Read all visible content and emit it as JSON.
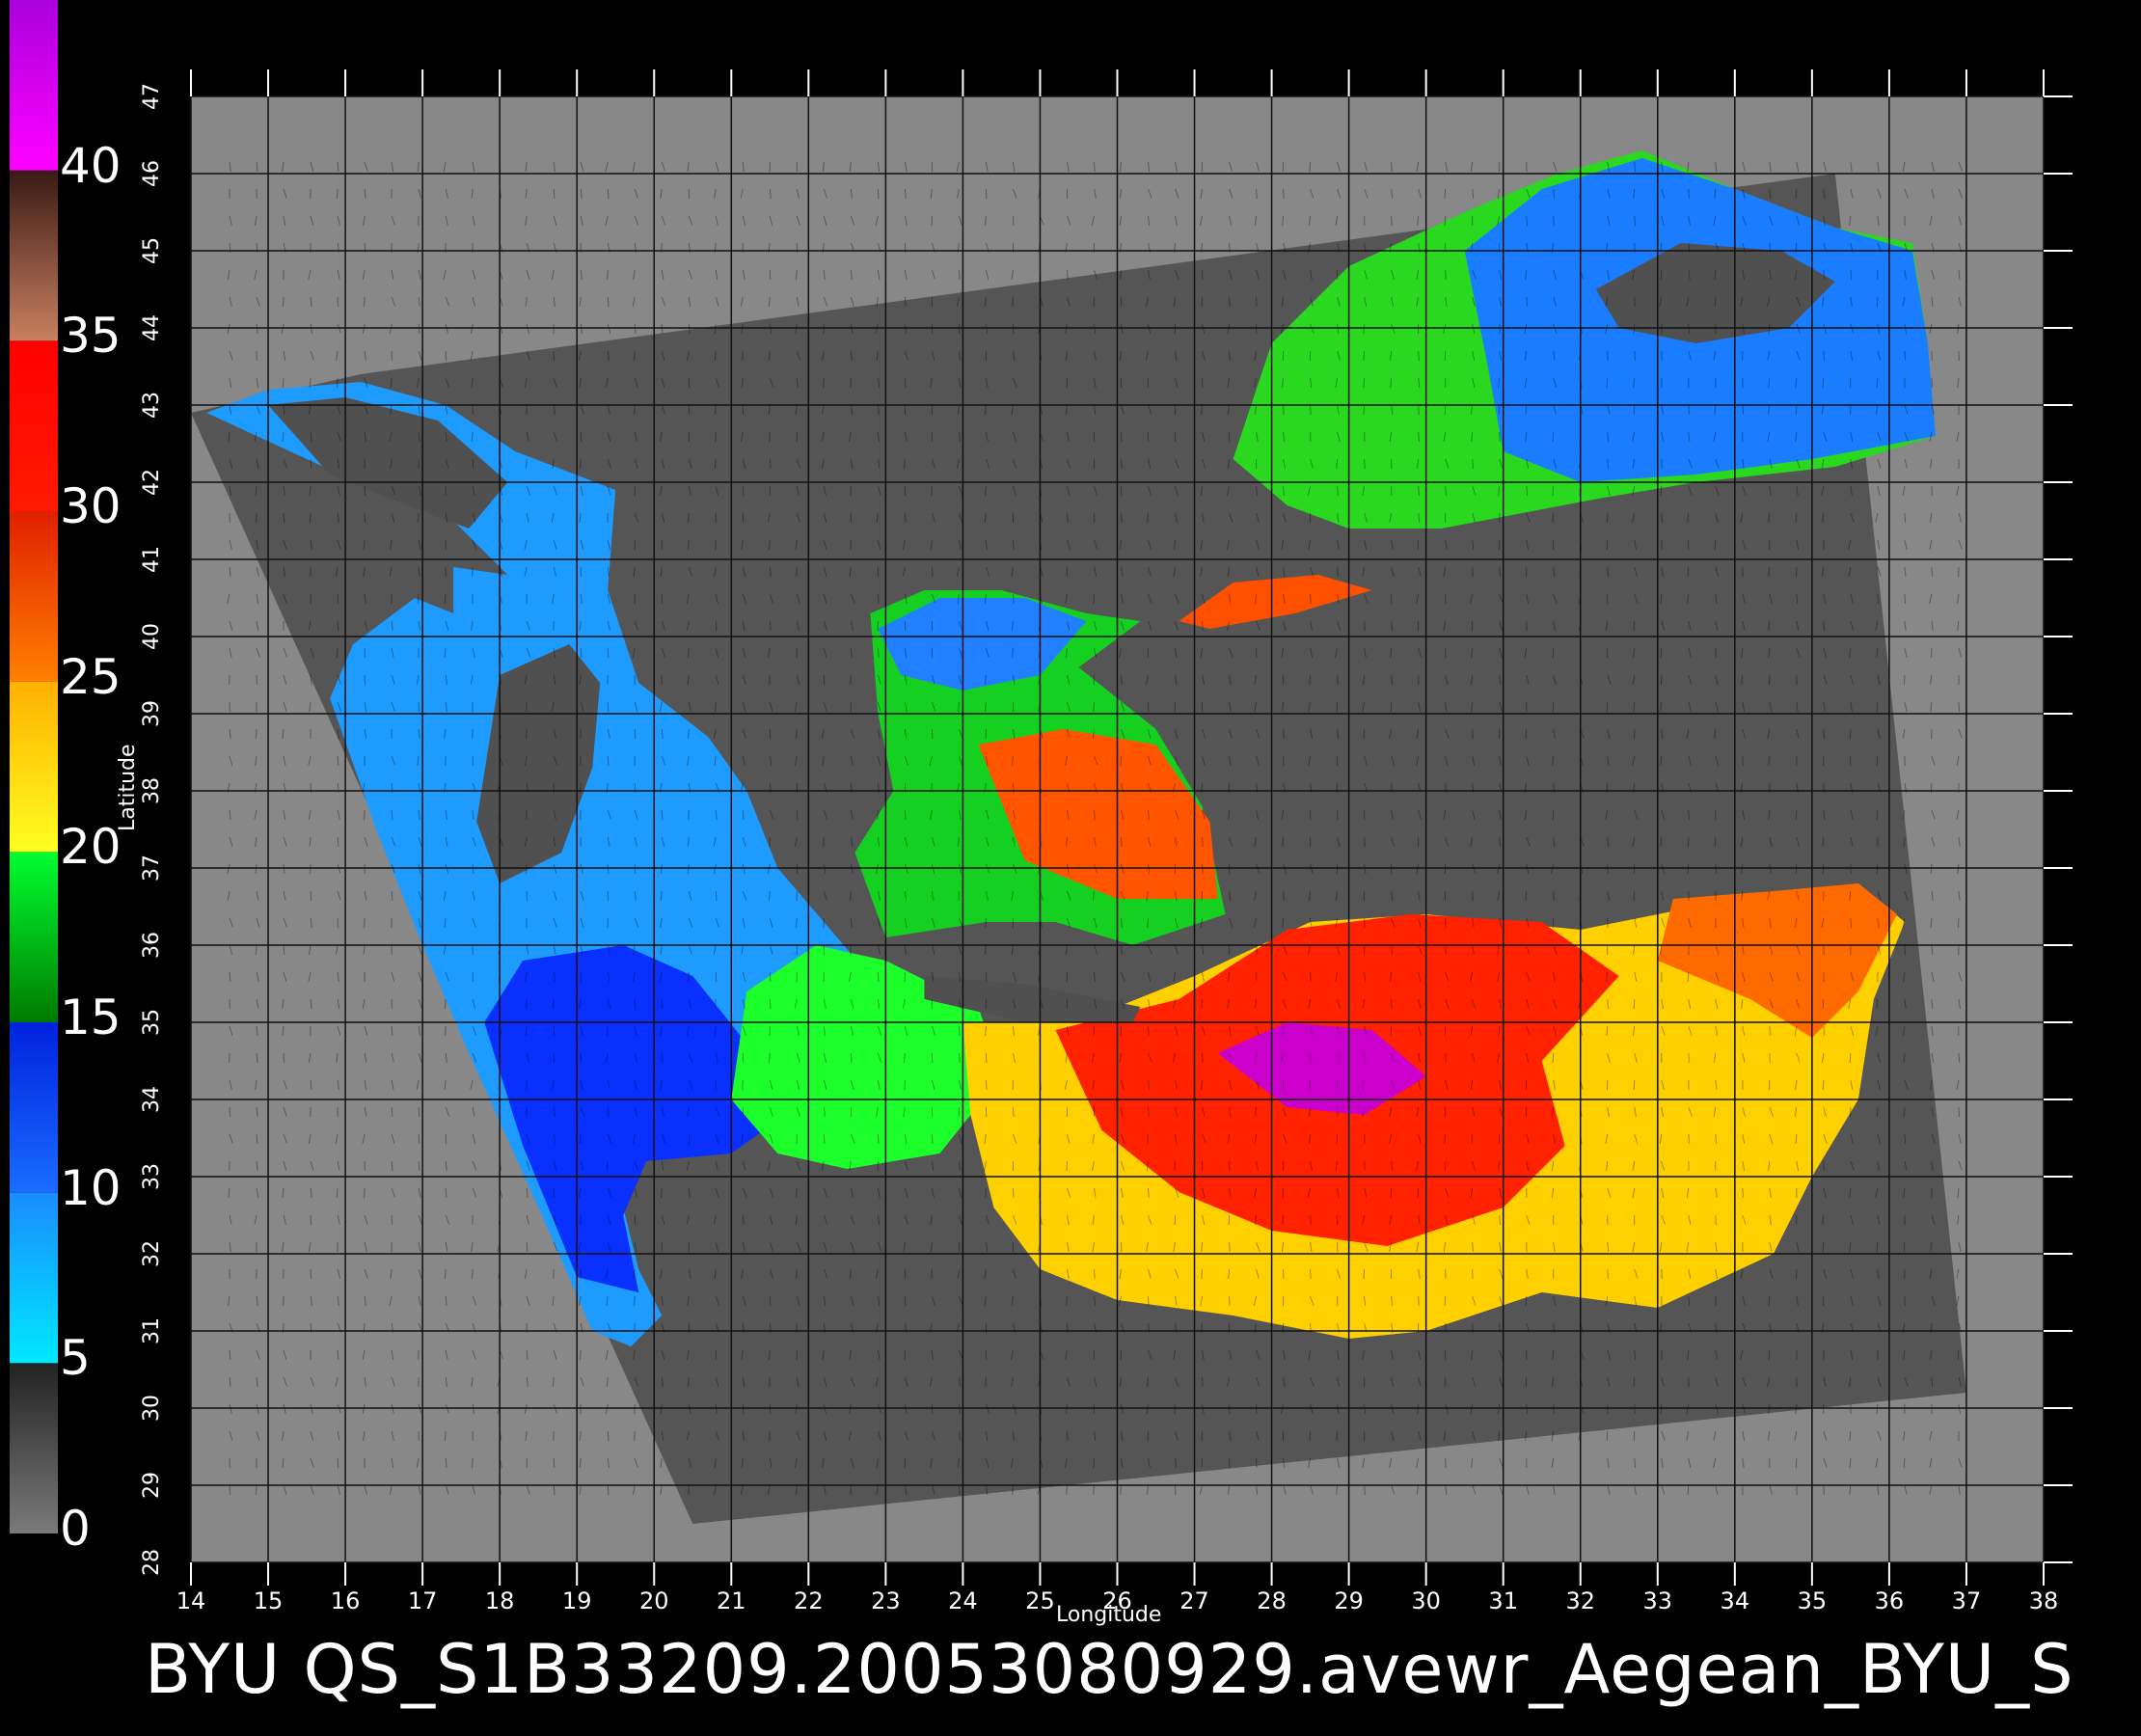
{
  "title": "BYU  QS_S1B33209.20053080929.avewr_Aegean_BYU_S",
  "colorbar": {
    "labels": [
      "40",
      "35",
      "30",
      "25",
      "20",
      "15",
      "10",
      "5",
      "0"
    ],
    "segments": [
      {
        "from": 0,
        "to": 5,
        "colors": [
          "#7a7a7a",
          "#222222"
        ]
      },
      {
        "from": 5,
        "to": 10,
        "colors": [
          "#00e8ff",
          "#1a8cff"
        ]
      },
      {
        "from": 10,
        "to": 15,
        "colors": [
          "#1a6cff",
          "#0022dd"
        ]
      },
      {
        "from": 15,
        "to": 20,
        "colors": [
          "#007a00",
          "#00ff30"
        ]
      },
      {
        "from": 20,
        "to": 25,
        "colors": [
          "#ffff20",
          "#ffb000"
        ]
      },
      {
        "from": 25,
        "to": 30,
        "colors": [
          "#ff8000",
          "#e02000"
        ]
      },
      {
        "from": 30,
        "to": 35,
        "colors": [
          "#ff1a00",
          "#ff0000"
        ]
      },
      {
        "from": 35,
        "to": 40,
        "colors": [
          "#c88060",
          "#3a1a14"
        ]
      },
      {
        "from": 40,
        "to": 45,
        "colors": [
          "#ff00ff",
          "#aa00dd"
        ]
      }
    ]
  },
  "axes": {
    "xlabel": "Longitude",
    "ylabel": "Latitude",
    "xlim": [
      14,
      38
    ],
    "ylim": [
      28,
      47
    ],
    "xticks": [
      14,
      15,
      16,
      17,
      18,
      19,
      20,
      21,
      22,
      23,
      24,
      25,
      26,
      27,
      28,
      29,
      30,
      31,
      32,
      33,
      34,
      35,
      36,
      37,
      38
    ],
    "yticks": [
      28,
      29,
      30,
      31,
      32,
      33,
      34,
      35,
      36,
      37,
      38,
      39,
      40,
      41,
      42,
      43,
      44,
      45,
      46,
      47
    ],
    "grid": true
  },
  "colors": {
    "background": "#000000",
    "land": "#888888",
    "swath": "#555555",
    "grid": "#111111"
  },
  "wind_regions": [
    {
      "name": "adriatic-ionian",
      "color": "#1e9bff",
      "outline": [
        [
          14.2,
          42.9
        ],
        [
          15.0,
          43.2
        ],
        [
          16.2,
          43.3
        ],
        [
          17.3,
          43.0
        ],
        [
          18.2,
          42.4
        ],
        [
          19.5,
          41.9
        ],
        [
          19.4,
          40.6
        ],
        [
          19.8,
          39.4
        ],
        [
          20.7,
          38.7
        ],
        [
          21.2,
          38.0
        ],
        [
          21.6,
          37.0
        ],
        [
          22.2,
          36.3
        ],
        [
          22.8,
          35.6
        ],
        [
          22.0,
          35.0
        ],
        [
          21.3,
          34.4
        ],
        [
          20.6,
          33.8
        ],
        [
          19.9,
          33.4
        ],
        [
          19.6,
          32.6
        ],
        [
          19.8,
          31.8
        ],
        [
          20.1,
          31.2
        ],
        [
          19.7,
          30.8
        ],
        [
          19.2,
          31.0
        ],
        [
          18.5,
          32.6
        ],
        [
          17.6,
          34.6
        ],
        [
          17.0,
          36.0
        ],
        [
          16.4,
          37.5
        ],
        [
          15.8,
          39.2
        ],
        [
          16.1,
          39.9
        ],
        [
          16.9,
          40.5
        ],
        [
          17.4,
          40.3
        ],
        [
          17.4,
          40.9
        ],
        [
          18.1,
          40.8
        ],
        [
          17.4,
          41.5
        ],
        [
          16.4,
          41.9
        ],
        [
          15.5,
          42.3
        ]
      ]
    },
    {
      "name": "adriatic-calm-1",
      "color": "#505050",
      "outline": [
        [
          15.0,
          43.0
        ],
        [
          16.0,
          43.1
        ],
        [
          17.2,
          42.8
        ],
        [
          18.1,
          42.0
        ],
        [
          17.6,
          41.4
        ],
        [
          16.8,
          41.7
        ],
        [
          15.8,
          42.1
        ]
      ]
    },
    {
      "name": "ionian-calm-2",
      "color": "#505050",
      "outline": [
        [
          18.0,
          39.5
        ],
        [
          18.9,
          39.9
        ],
        [
          19.3,
          39.4
        ],
        [
          19.2,
          38.3
        ],
        [
          18.8,
          37.2
        ],
        [
          18.0,
          36.8
        ],
        [
          17.7,
          37.6
        ]
      ]
    },
    {
      "name": "ionian-blue",
      "color": "#0a30ff",
      "outline": [
        [
          18.3,
          35.8
        ],
        [
          19.6,
          36.0
        ],
        [
          20.5,
          35.6
        ],
        [
          21.3,
          34.6
        ],
        [
          21.7,
          33.8
        ],
        [
          21.0,
          33.3
        ],
        [
          19.9,
          33.2
        ],
        [
          19.6,
          32.5
        ],
        [
          19.8,
          31.5
        ],
        [
          19.0,
          31.7
        ],
        [
          18.3,
          33.4
        ],
        [
          17.8,
          35.0
        ]
      ]
    },
    {
      "name": "libyan-green",
      "color": "#1cff2a",
      "outline": [
        [
          21.2,
          35.4
        ],
        [
          22.1,
          36.0
        ],
        [
          23.0,
          35.8
        ],
        [
          24.2,
          35.2
        ],
        [
          24.5,
          34.3
        ],
        [
          23.7,
          33.3
        ],
        [
          22.5,
          33.1
        ],
        [
          21.6,
          33.3
        ],
        [
          21.0,
          34.0
        ]
      ]
    },
    {
      "name": "aegean-mix",
      "color": "#15d020",
      "outline": [
        [
          22.8,
          40.3
        ],
        [
          23.5,
          40.6
        ],
        [
          24.5,
          40.6
        ],
        [
          25.6,
          40.3
        ],
        [
          26.3,
          40.2
        ],
        [
          25.5,
          39.6
        ],
        [
          26.5,
          38.8
        ],
        [
          27.1,
          37.8
        ],
        [
          27.4,
          36.4
        ],
        [
          26.2,
          36.0
        ],
        [
          25.2,
          36.3
        ],
        [
          24.3,
          36.3
        ],
        [
          23.0,
          36.1
        ],
        [
          22.6,
          37.2
        ],
        [
          23.1,
          38.0
        ],
        [
          22.9,
          39.0
        ]
      ]
    },
    {
      "name": "aegean-blue",
      "color": "#2080ff",
      "outline": [
        [
          22.9,
          40.1
        ],
        [
          23.7,
          40.5
        ],
        [
          24.8,
          40.5
        ],
        [
          25.6,
          40.2
        ],
        [
          25.0,
          39.5
        ],
        [
          24.0,
          39.3
        ],
        [
          23.2,
          39.5
        ]
      ]
    },
    {
      "name": "aegean-orange",
      "color": "#ff5500",
      "outline": [
        [
          24.2,
          38.6
        ],
        [
          25.3,
          38.8
        ],
        [
          26.5,
          38.6
        ],
        [
          27.2,
          37.6
        ],
        [
          27.3,
          36.6
        ],
        [
          26.0,
          36.6
        ],
        [
          24.8,
          37.1
        ]
      ]
    },
    {
      "name": "levantine-yellow",
      "color": "#ffd000",
      "outline": [
        [
          24.0,
          35.0
        ],
        [
          25.5,
          35.0
        ],
        [
          27.0,
          35.6
        ],
        [
          28.5,
          36.3
        ],
        [
          30.0,
          36.4
        ],
        [
          32.0,
          36.2
        ],
        [
          34.0,
          36.6
        ],
        [
          35.6,
          36.8
        ],
        [
          36.2,
          36.3
        ],
        [
          35.8,
          35.3
        ],
        [
          35.6,
          34.0
        ],
        [
          35.0,
          33.0
        ],
        [
          34.5,
          32.0
        ],
        [
          33.0,
          31.3
        ],
        [
          31.5,
          31.5
        ],
        [
          30.0,
          31.0
        ],
        [
          29.0,
          30.9
        ],
        [
          27.5,
          31.2
        ],
        [
          26.0,
          31.4
        ],
        [
          25.0,
          31.8
        ],
        [
          24.4,
          32.6
        ],
        [
          24.1,
          33.8
        ]
      ]
    },
    {
      "name": "levantine-red",
      "color": "#ff2200",
      "outline": [
        [
          25.2,
          34.9
        ],
        [
          26.8,
          35.3
        ],
        [
          28.2,
          36.2
        ],
        [
          29.8,
          36.4
        ],
        [
          31.5,
          36.3
        ],
        [
          32.5,
          35.6
        ],
        [
          31.5,
          34.5
        ],
        [
          31.8,
          33.4
        ],
        [
          31.0,
          32.6
        ],
        [
          29.5,
          32.1
        ],
        [
          28.0,
          32.3
        ],
        [
          26.8,
          32.8
        ],
        [
          25.8,
          33.6
        ]
      ]
    },
    {
      "name": "levantine-magenta",
      "color": "#cc00cc",
      "outline": [
        [
          27.3,
          34.6
        ],
        [
          28.2,
          35.0
        ],
        [
          29.3,
          34.9
        ],
        [
          30.0,
          34.3
        ],
        [
          29.2,
          33.8
        ],
        [
          28.2,
          33.9
        ]
      ]
    },
    {
      "name": "levantine-orange-east",
      "color": "#ff6a00",
      "outline": [
        [
          33.2,
          36.6
        ],
        [
          34.5,
          36.7
        ],
        [
          35.6,
          36.8
        ],
        [
          36.1,
          36.4
        ],
        [
          35.6,
          35.4
        ],
        [
          35.0,
          34.8
        ],
        [
          34.2,
          35.3
        ],
        [
          33.0,
          35.8
        ]
      ]
    },
    {
      "name": "crete-calm",
      "color": "#505050",
      "outline": [
        [
          23.5,
          35.6
        ],
        [
          24.8,
          35.5
        ],
        [
          26.3,
          35.2
        ],
        [
          26.2,
          35.0
        ],
        [
          24.8,
          35.0
        ],
        [
          23.5,
          35.3
        ]
      ]
    },
    {
      "name": "black-sea-green",
      "color": "#2ad820",
      "outline": [
        [
          27.6,
          42.6
        ],
        [
          28.0,
          43.8
        ],
        [
          29.0,
          44.8
        ],
        [
          30.5,
          45.5
        ],
        [
          31.7,
          46.0
        ],
        [
          32.8,
          46.3
        ],
        [
          34.0,
          45.8
        ],
        [
          35.3,
          45.3
        ],
        [
          36.3,
          45.1
        ],
        [
          36.5,
          43.8
        ],
        [
          36.6,
          42.6
        ],
        [
          35.3,
          42.2
        ],
        [
          33.5,
          42.0
        ],
        [
          32.3,
          41.8
        ],
        [
          30.2,
          41.4
        ],
        [
          29.0,
          41.4
        ],
        [
          28.2,
          41.7
        ],
        [
          27.5,
          42.3
        ]
      ]
    },
    {
      "name": "black-sea-blue",
      "color": "#1a7cff",
      "outline": [
        [
          30.5,
          45.0
        ],
        [
          31.5,
          45.8
        ],
        [
          32.8,
          46.2
        ],
        [
          34.0,
          45.8
        ],
        [
          35.3,
          45.3
        ],
        [
          36.3,
          45.0
        ],
        [
          36.5,
          43.8
        ],
        [
          36.6,
          42.6
        ],
        [
          35.0,
          42.3
        ],
        [
          33.5,
          42.1
        ],
        [
          32.0,
          42.0
        ],
        [
          31.0,
          42.4
        ],
        [
          30.8,
          43.5
        ]
      ]
    },
    {
      "name": "black-sea-calm",
      "color": "#505050",
      "outline": [
        [
          32.2,
          44.5
        ],
        [
          33.3,
          45.1
        ],
        [
          34.6,
          45.0
        ],
        [
          35.3,
          44.6
        ],
        [
          34.7,
          44.0
        ],
        [
          33.5,
          43.8
        ],
        [
          32.5,
          44.0
        ]
      ]
    },
    {
      "name": "marmara-orange",
      "color": "#ff5000",
      "outline": [
        [
          26.8,
          40.2
        ],
        [
          27.5,
          40.7
        ],
        [
          28.6,
          40.8
        ],
        [
          29.3,
          40.6
        ],
        [
          28.3,
          40.3
        ],
        [
          27.2,
          40.1
        ]
      ]
    }
  ]
}
